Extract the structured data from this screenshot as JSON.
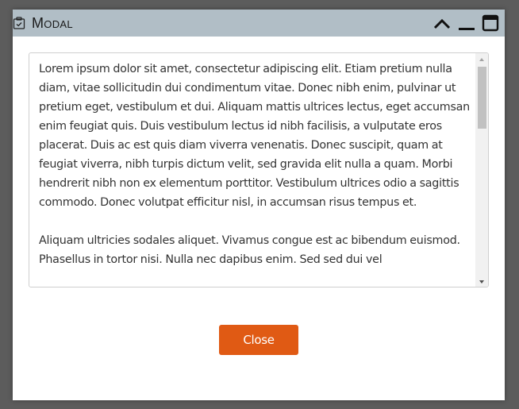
{
  "modal": {
    "title": "Modal",
    "title_icon": "clipboard-check-icon",
    "controls": {
      "collapse_icon": "chevron-up-icon",
      "minimize_icon": "minimize-icon",
      "maximize_icon": "maximize-icon"
    },
    "textarea": {
      "paragraphs": [
        "Lorem ipsum dolor sit amet, consectetur adipiscing elit. Etiam pretium nulla diam, vitae sollicitudin dui condimentum vitae. Donec nibh enim, pulvinar ut pretium eget, vestibulum et dui. Aliquam mattis ultrices lectus, eget accumsan enim feugiat quis. Duis vestibulum lectus id nibh facilisis, a vulputate eros placerat. Duis ac est quis diam viverra venenatis. Donec suscipit, quam at feugiat viverra, nibh turpis dictum velit, sed gravida elit nulla a quam. Morbi hendrerit nibh non ex elementum porttitor. Vestibulum ultrices odio a sagittis commodo. Donec volutpat efficitur nisl, in accumsan risus tempus et.",
        "Aliquam ultricies sodales aliquet. Vivamus congue est ac bibendum euismod. Phasellus in tortor nisi. Nulla nec dapibus enim. Sed sed dui vel"
      ]
    },
    "close_label": "Close"
  },
  "colors": {
    "titlebar_bg": "#b1bec6",
    "close_button_bg": "#e05a14",
    "backdrop": "#5c5c5c"
  }
}
